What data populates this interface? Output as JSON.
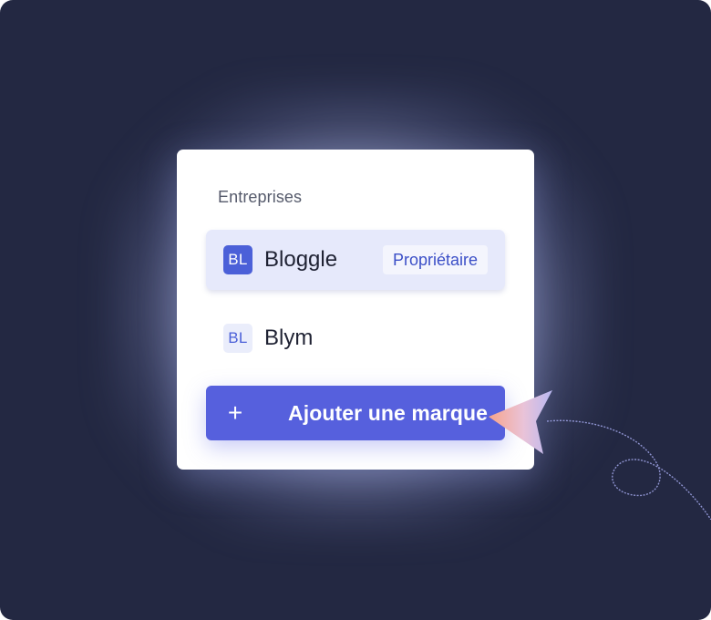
{
  "menu": {
    "section_label": "Entreprises",
    "companies": [
      {
        "initials": "BL",
        "name": "Bloggle",
        "badge": "Propriétaire",
        "selected": true
      },
      {
        "initials": "BL",
        "name": "Blym",
        "badge": "",
        "selected": false
      }
    ],
    "add_button": {
      "icon": "plus-icon",
      "label": "Ajouter une marque"
    }
  },
  "colors": {
    "background": "#232842",
    "accent": "#5660dd",
    "selected_row": "#e6e9fb",
    "avatar_solid": "#4b60d8",
    "badge_text": "#3b4fc7"
  },
  "decor": {
    "cursor": "pointer-arrow-icon",
    "trail": "curly-trail-line"
  }
}
